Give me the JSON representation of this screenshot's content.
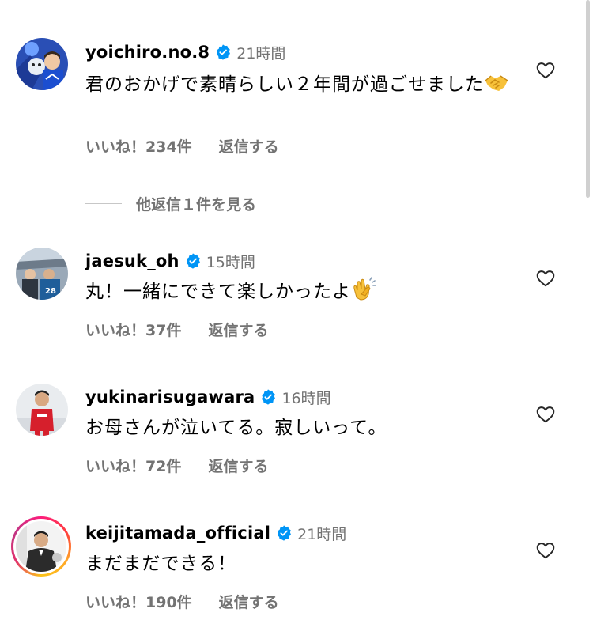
{
  "comments": [
    {
      "username": "yoichiro.no.8",
      "time": "21時間",
      "text": "君のおかげで素晴らしい２年間が過ごせました",
      "emoji": "handshake-emoji",
      "likes": "いいね！234件",
      "reply": "返信する"
    },
    {
      "username": "jaesuk_oh",
      "time": "15時間",
      "text": "丸！一緒にできて楽しかったよ",
      "emoji": "clapping-hands-emoji",
      "likes": "いいね！37件",
      "reply": "返信する"
    },
    {
      "username": "yukinarisugawara",
      "time": "16時間",
      "text": "お母さんが泣いてる。寂しいって。",
      "likes": "いいね！72件",
      "reply": "返信する"
    },
    {
      "username": "keijitamada_official",
      "time": "21時間",
      "text": "まだまだできる！",
      "likes": "いいね！190件",
      "reply": "返信する"
    }
  ],
  "more_replies_label": "他返信１件を見る",
  "icons": {
    "verified": "verified-badge-icon",
    "like": "heart-outline-icon"
  },
  "colors": {
    "verified": "#0095f6",
    "secondary_text": "#737373",
    "story_ring": "#e1306c"
  }
}
